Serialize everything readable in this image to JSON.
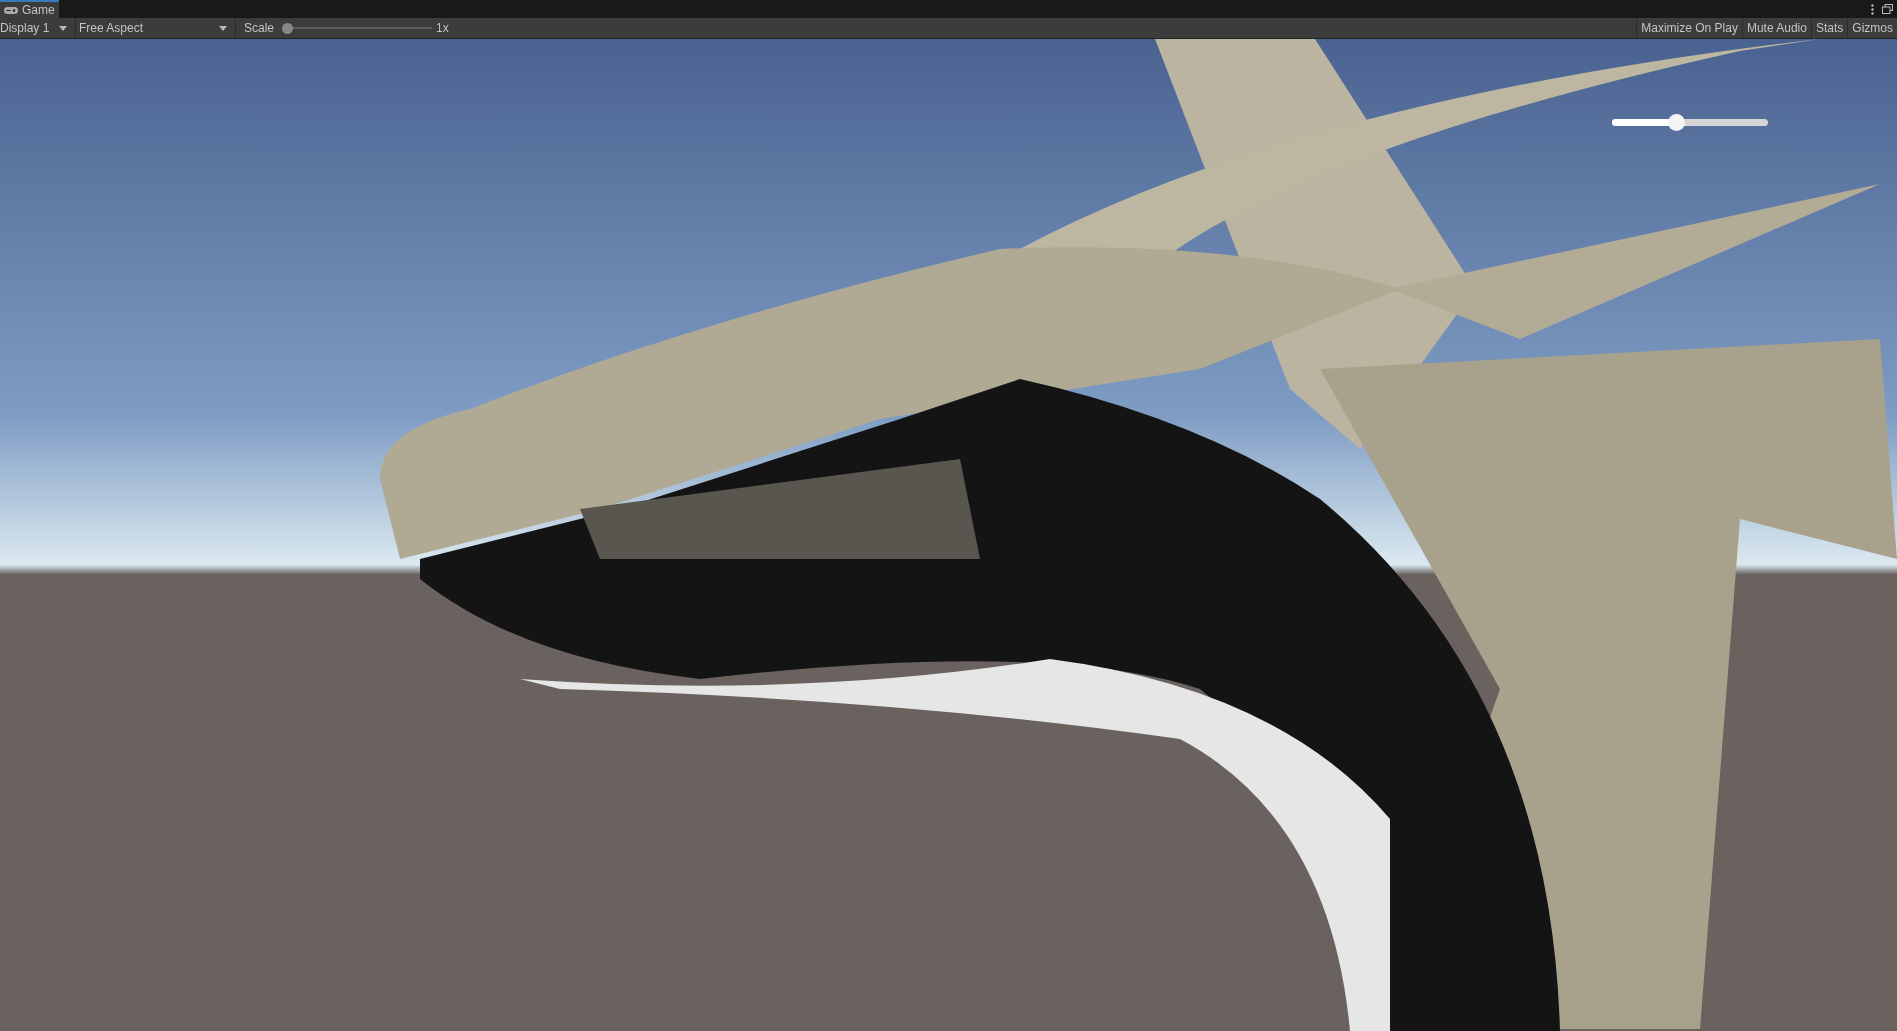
{
  "window": {
    "tab": {
      "label": "Game",
      "selected": true
    }
  },
  "toolbar": {
    "display": "Display 1",
    "aspect": "Free Aspect",
    "scale": {
      "label": "Scale",
      "level": 0.0,
      "reading": "1x"
    },
    "toggles": [
      {
        "label": "Maximize On Play",
        "on": false
      },
      {
        "label": "Mute Audio",
        "on": false
      },
      {
        "label": "Stats",
        "on": false
      },
      {
        "label": "Gizmos",
        "on": false
      }
    ]
  },
  "game_view": {
    "slider": {
      "level": 0.41
    }
  }
}
